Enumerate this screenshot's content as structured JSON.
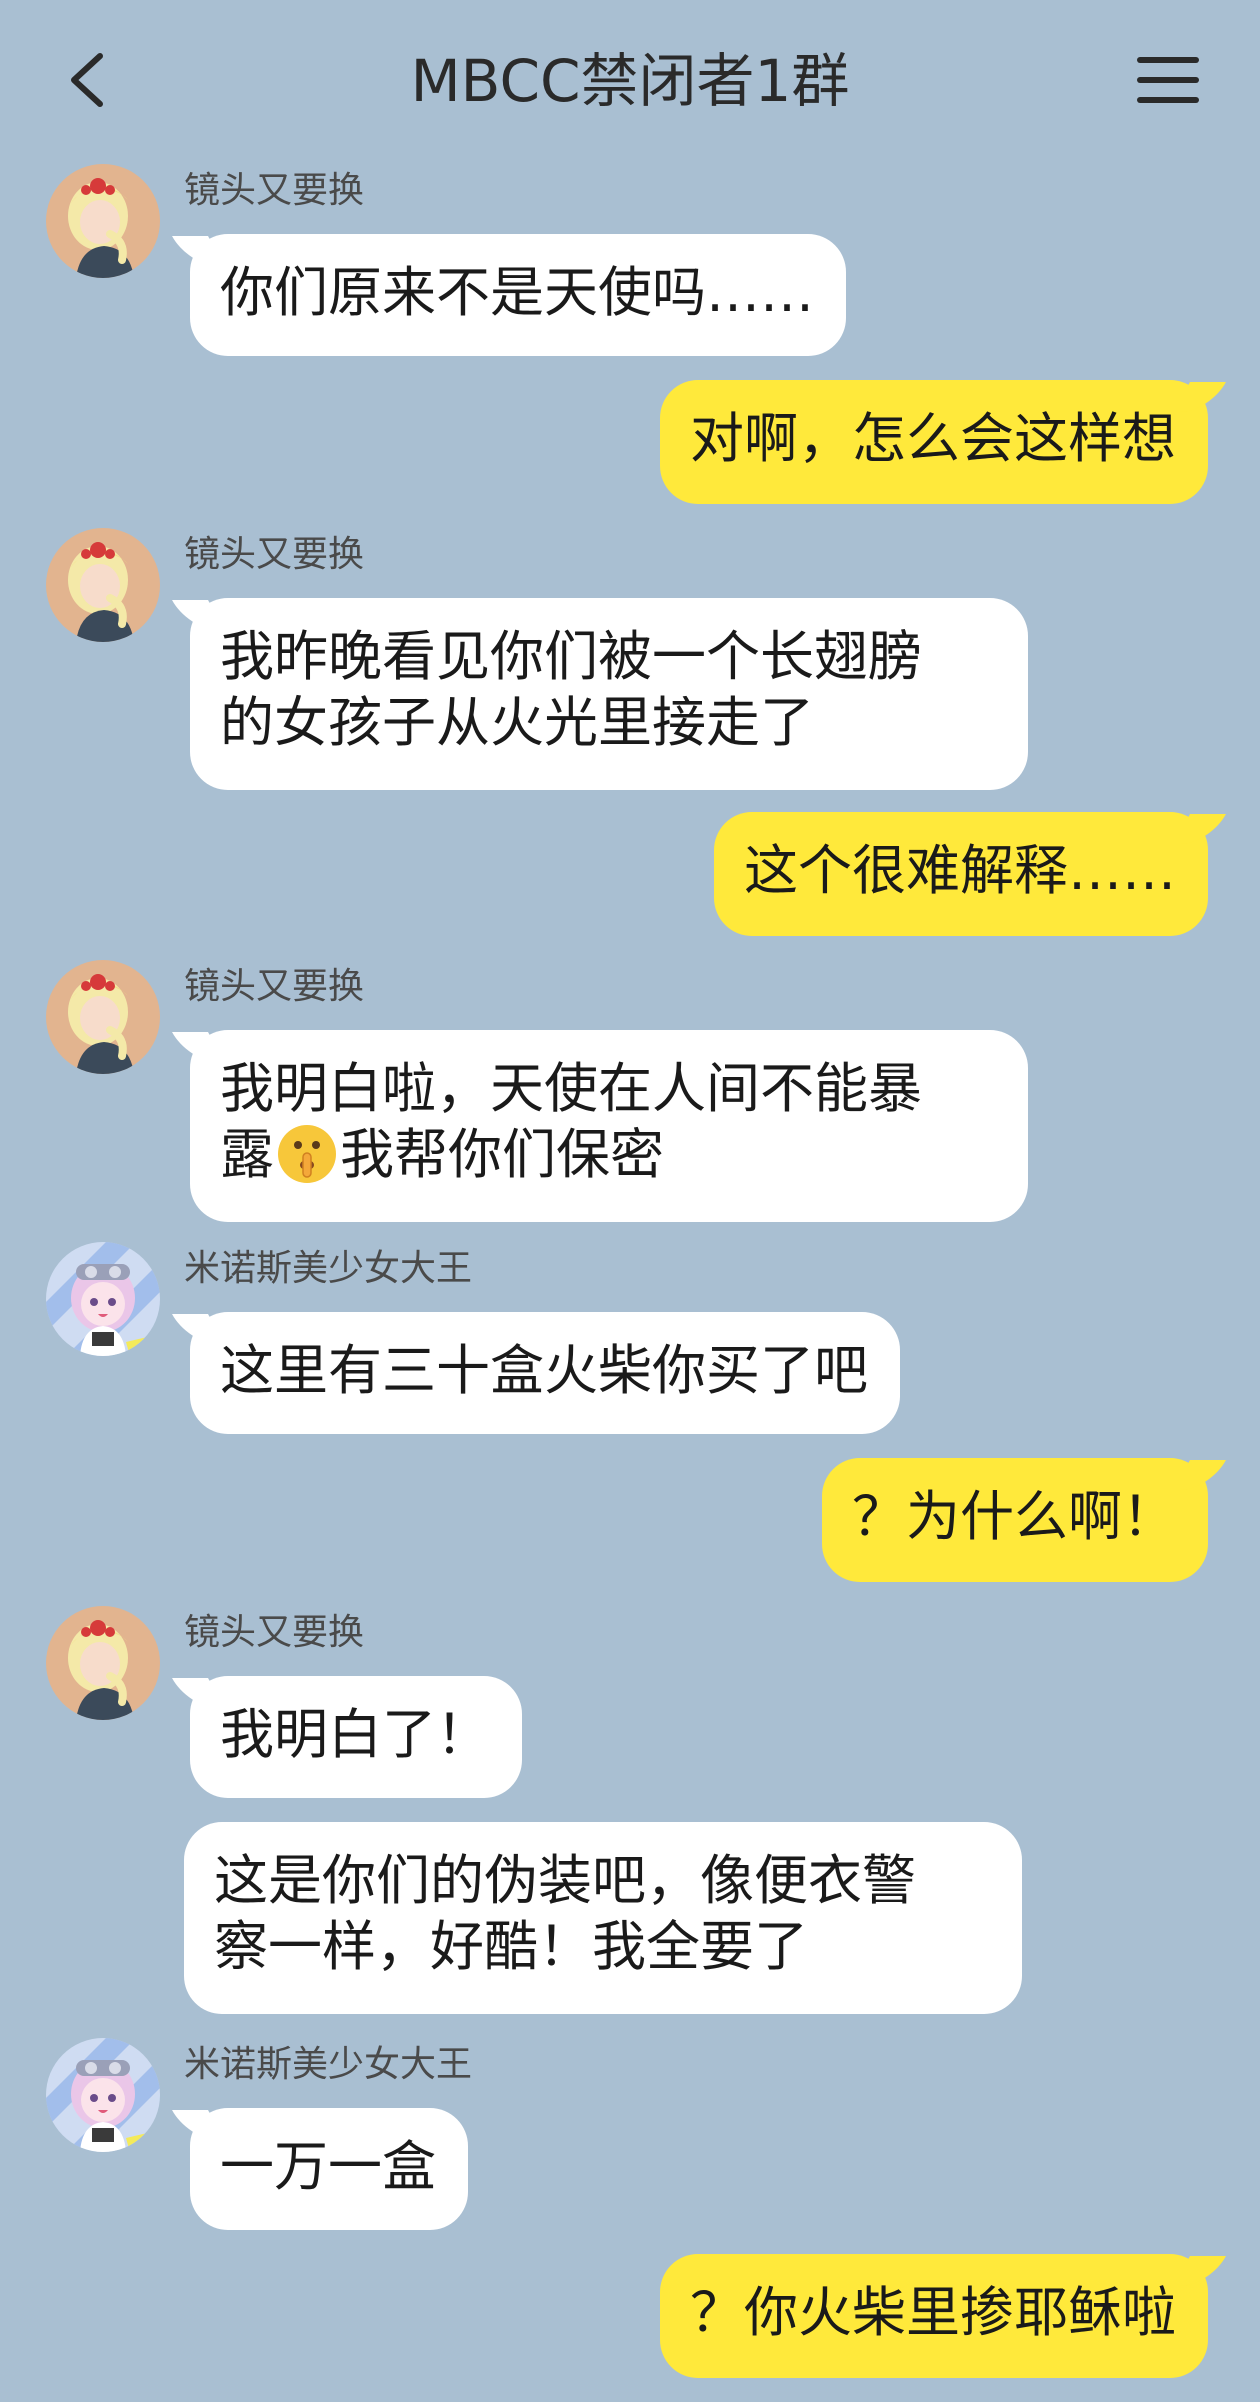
{
  "header": {
    "title": "MBCC禁闭者1群",
    "back_icon": "chevron-left-icon",
    "menu_icon": "hamburger-menu-icon"
  },
  "colors": {
    "background": "#a9bfd2",
    "incoming_bubble": "#ffffff",
    "outgoing_bubble": "#ffe93b"
  },
  "messages": [
    {
      "sender": "镜头又要换",
      "text": "你们原来不是天使吗……"
    },
    {
      "sender": "me",
      "text": "对啊，怎么会这样想"
    },
    {
      "sender": "镜头又要换",
      "line1": "我昨晚看见你们被一个长翅膀",
      "line2": "的女孩子从火光里接走了"
    },
    {
      "sender": "me",
      "text": "这个很难解释……"
    },
    {
      "sender": "镜头又要换",
      "line1": "我明白啦，天使在人间不能暴",
      "line2a": "露",
      "emoji": "shushing-face-emoji",
      "line2b": "我帮你们保密"
    },
    {
      "sender": "米诺斯美少女大王",
      "text": "这里有三十盒火柴你买了吧"
    },
    {
      "sender": "me",
      "text": "？为什么啊！"
    },
    {
      "sender": "镜头又要换",
      "text": "我明白了！"
    },
    {
      "sender": "镜头又要换",
      "line1": "这是你们的伪装吧，像便衣警",
      "line2": "察一样，好酷！我全要了"
    },
    {
      "sender": "米诺斯美少女大王",
      "text": "一万一盒"
    },
    {
      "sender": "me",
      "text": "？你火柴里掺耶稣啦"
    }
  ]
}
